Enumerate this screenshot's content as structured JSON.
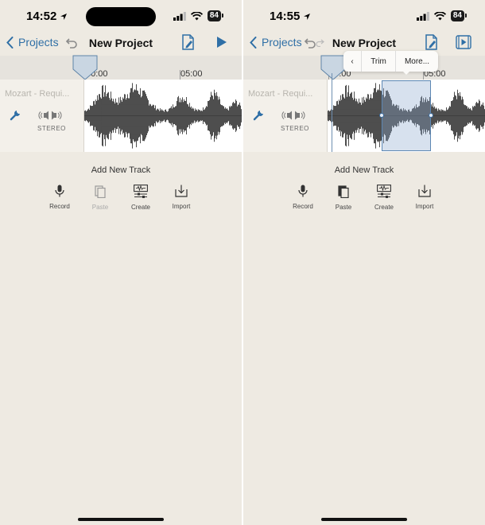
{
  "left": {
    "status": {
      "time": "14:52",
      "battery": "84"
    },
    "nav": {
      "back_label": "Projects",
      "title": "New Project"
    },
    "ruler": {
      "mark1": "00:00",
      "mark2": "05:00"
    },
    "track": {
      "name": "Mozart - Requi...",
      "channel": "STEREO"
    },
    "add_track": {
      "title": "Add New Track",
      "tools": [
        {
          "label": "Record",
          "icon": "mic-icon",
          "enabled": true
        },
        {
          "label": "Paste",
          "icon": "paste-icon",
          "enabled": false
        },
        {
          "label": "Create",
          "icon": "create-icon",
          "enabled": true
        },
        {
          "label": "Import",
          "icon": "import-icon",
          "enabled": true
        }
      ]
    }
  },
  "right": {
    "status": {
      "time": "14:55",
      "battery": "84"
    },
    "nav": {
      "back_label": "Projects",
      "title": "New Project"
    },
    "ruler": {
      "mark1": "00:00",
      "mark2": "05:00"
    },
    "track": {
      "name": "Mozart - Requi...",
      "channel": "STEREO"
    },
    "popup": {
      "back": "‹",
      "trim": "Trim",
      "more": "More..."
    },
    "add_track": {
      "title": "Add New Track",
      "tools": [
        {
          "label": "Record",
          "icon": "mic-icon",
          "enabled": true
        },
        {
          "label": "Paste",
          "icon": "paste-icon",
          "enabled": true
        },
        {
          "label": "Create",
          "icon": "create-icon",
          "enabled": true
        },
        {
          "label": "Import",
          "icon": "import-icon",
          "enabled": true
        }
      ]
    }
  },
  "colors": {
    "accent": "#2f6fa6",
    "background": "#eeeae2",
    "waveform": "#3a3a3a"
  }
}
